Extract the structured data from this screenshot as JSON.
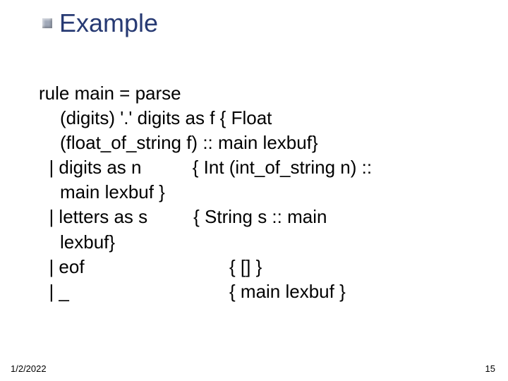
{
  "title": "Example",
  "body": {
    "l1": "rule main = parse",
    "l2": "(digits) '.' digits as f { Float",
    "l3": "(float_of_string f) :: main lexbuf}",
    "l4": "| digits as n          { Int (int_of_string n) ::",
    "l5": "main lexbuf }",
    "l6": "| letters as s         { String s :: main",
    "l7": "lexbuf}",
    "l8a": "| eof",
    "l8b": "{ [] }",
    "l9a": "| _",
    "l9b": "{ main lexbuf }"
  },
  "footer": {
    "date": "1/2/2022",
    "page": "15"
  }
}
